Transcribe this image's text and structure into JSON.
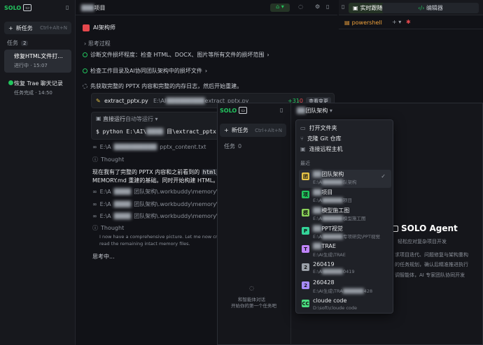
{
  "sidebar": {
    "logo_text": "SOLO",
    "new_task_label": "新任务",
    "new_task_shortcut": "Ctrl+Alt+N",
    "tasks_label": "任务",
    "tasks_count": "2",
    "tasks": [
      {
        "title": "修复HTML文件打...",
        "status": "进行中 · 15:07"
      },
      {
        "title": "恢复 Trae 聊天记录",
        "status": "任务完成 · 14:50"
      }
    ]
  },
  "topbar": {
    "title": "项目"
  },
  "agent": {
    "name": "AI架构师",
    "thinking_label": "思考过程",
    "step1": "诊断文件损坏程度：检查 HTML、DOCX、图片等所有文件的损坏范围",
    "step2": "检查工作目录及AI协同团队架构中的损坏文件",
    "step3": "先获取完整的 PPTX 内容和完整的内存日志，然后开始重建。",
    "code_file": "extract_pptx.py",
    "code_path_short": "E:\\AI",
    "code_path_tail": "extract_pptx.py",
    "code_add": "+31",
    "code_del": "-0",
    "view_changes": "查看变更",
    "term_label": "直接运行",
    "term_auto": "自动等运行",
    "term_cmd": "$ python E:\\AI\\",
    "term_cmd_tail": "目\\extract_pptx.py",
    "file_read1": "E:\\A",
    "file_read1_tail": "pptx_content.txt",
    "thought_label": "Thought",
    "body_line1a": "现在我有了完整的 PPTX 内容和之前看到的",
    "body_code": "html_to_",
    "body_line2": "MEMORY.md 重建的基础。同时开始构建 HTML。",
    "mem1": "团队架构\\.workbuddy\\memory\\2026-05-04.",
    "mem2": "团队架构\\.workbuddy\\memory\\2026-05-05.",
    "mem3": "团队架构\\.workbuddy\\memory\\2026-05-10.",
    "thought2_line1": "I now have a comprehensive picture. Let me now create the H",
    "thought2_line2": "read the remaining intact memory files.",
    "thinking_now": "思考中..."
  },
  "right_pane": {
    "tab_live": "实时跟随",
    "tab_editor": "编辑器",
    "terminal_tab": "powershell"
  },
  "overlay": {
    "logo_text": "SOLO",
    "title": "团队架构",
    "new_task_label": "新任务",
    "new_task_shortcut": "Ctrl+Alt+N",
    "tasks_label": "任务",
    "tasks_count": "0",
    "empty_line1": "和智能体对话",
    "empty_line2": "开始你的第一个任务吧",
    "agent_title": "SOLO Agent",
    "agent_subtitle": "轻松应对复杂项目开发",
    "desc1": "求项目迭代、问题修复与架构重构",
    "desc2": "的任务规划，确认后精准推进执行",
    "desc3": "调智能体，AI 专家团队协同开发"
  },
  "menu": {
    "open_folder": "打开文件夹",
    "clone_git": "克隆 Git 仓库",
    "connect_remote": "连接远程主机",
    "recent_label": "最近",
    "projects": [
      {
        "name": "团队架构",
        "path": "E:\\A",
        "path_tail": "队架构",
        "initial": "团",
        "color": "#e8c547"
      },
      {
        "name": "项目",
        "path": "E:\\A",
        "path_tail": "项目",
        "initial": "项",
        "color": "#22c55e"
      },
      {
        "name": "模型施工图",
        "path": "E:\\A",
        "path_tail": "模型施工图",
        "initial": "模",
        "color": "#8bd35a"
      },
      {
        "name": "PPT视觉",
        "path": "E:\\A",
        "path_tail": "专项研究\\PPT视觉",
        "initial": "P",
        "color": "#34d399"
      },
      {
        "name": "TRAE",
        "path": "E:\\AI生成\\TRAE",
        "path_tail": "",
        "initial": "T",
        "color": "#c084fc"
      },
      {
        "name": "260419",
        "path": "E:\\A",
        "path_tail": "0419",
        "initial": "2",
        "color": "#9aa0a8"
      },
      {
        "name": "260428",
        "path": "E:\\AI生成\\TRA",
        "path_tail": "428",
        "initial": "2",
        "color": "#a78bfa"
      },
      {
        "name": "cloude code",
        "path": "D:\\soft\\cloude code",
        "path_tail": "",
        "initial": "CC",
        "color": "#4ade80"
      }
    ]
  }
}
